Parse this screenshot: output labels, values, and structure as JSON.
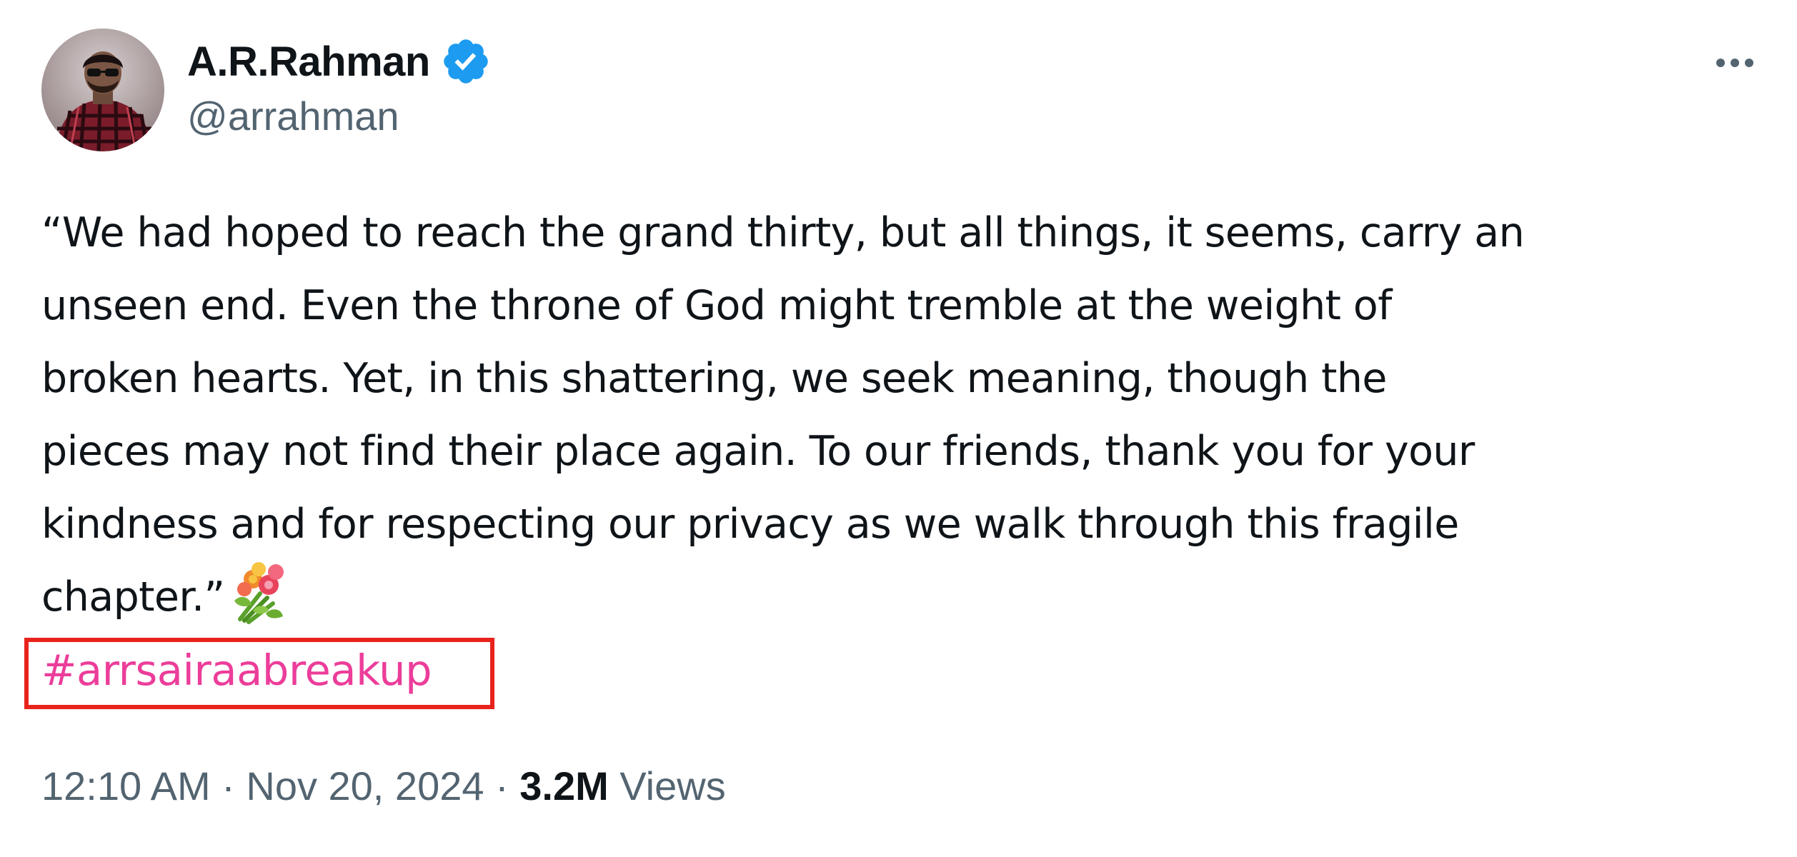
{
  "author": {
    "display_name": "A.R.Rahman",
    "handle": "@arrahman",
    "verified": true
  },
  "tweet": {
    "text": "“We had hoped to reach the grand thirty, but all things, it seems, carry an\nunseen end. Even the throne of God might tremble at the weight of\nbroken hearts. Yet, in this shattering, we seek meaning, though the\npieces may not find their place again. To our friends, thank you for your\nkindness and for respecting our privacy as we walk through this fragile\nchapter.”",
    "emoji": "bouquet",
    "hashtag": "#arrsairaabreakup"
  },
  "meta": {
    "time": "12:10 AM",
    "separator": " · ",
    "date": "Nov 20, 2024",
    "views_count": "3.2M",
    "views_label": " Views"
  },
  "colors": {
    "verified": "#1d9bf0",
    "hashtag": "#ec3d9a",
    "highlight_box": "#e8231c",
    "secondary_text": "#536471",
    "primary_text": "#0f1419"
  },
  "icons": {
    "verified": "verified-badge-icon",
    "more": "more-options-icon",
    "emoji": "bouquet-emoji-icon"
  }
}
